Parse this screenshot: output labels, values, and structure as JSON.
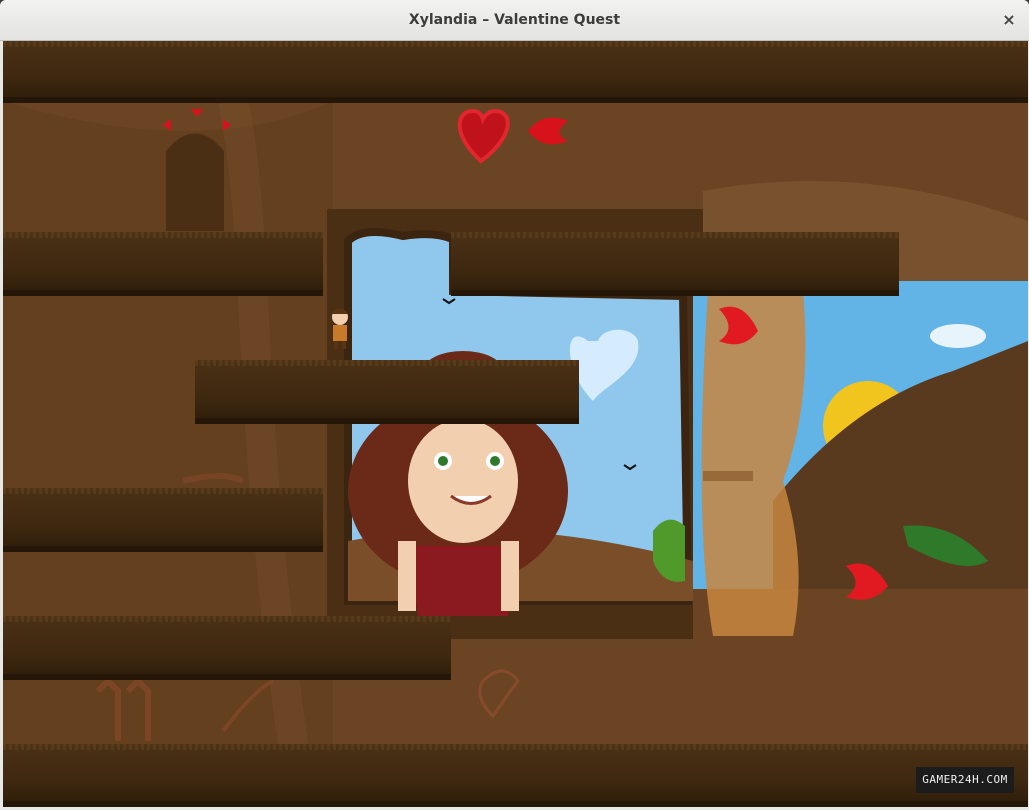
{
  "window": {
    "title": "Xylandia – Valentine Quest",
    "close_glyph": "×"
  },
  "game": {
    "sky_color": "#8ec7ec",
    "dirt_color": "#6a4422",
    "heart_color": "#d8121a",
    "lives_icon": "heart-icon",
    "collectible_icon": "heart-half-icon"
  },
  "watermark": {
    "text": "GAMER24H.COM"
  }
}
